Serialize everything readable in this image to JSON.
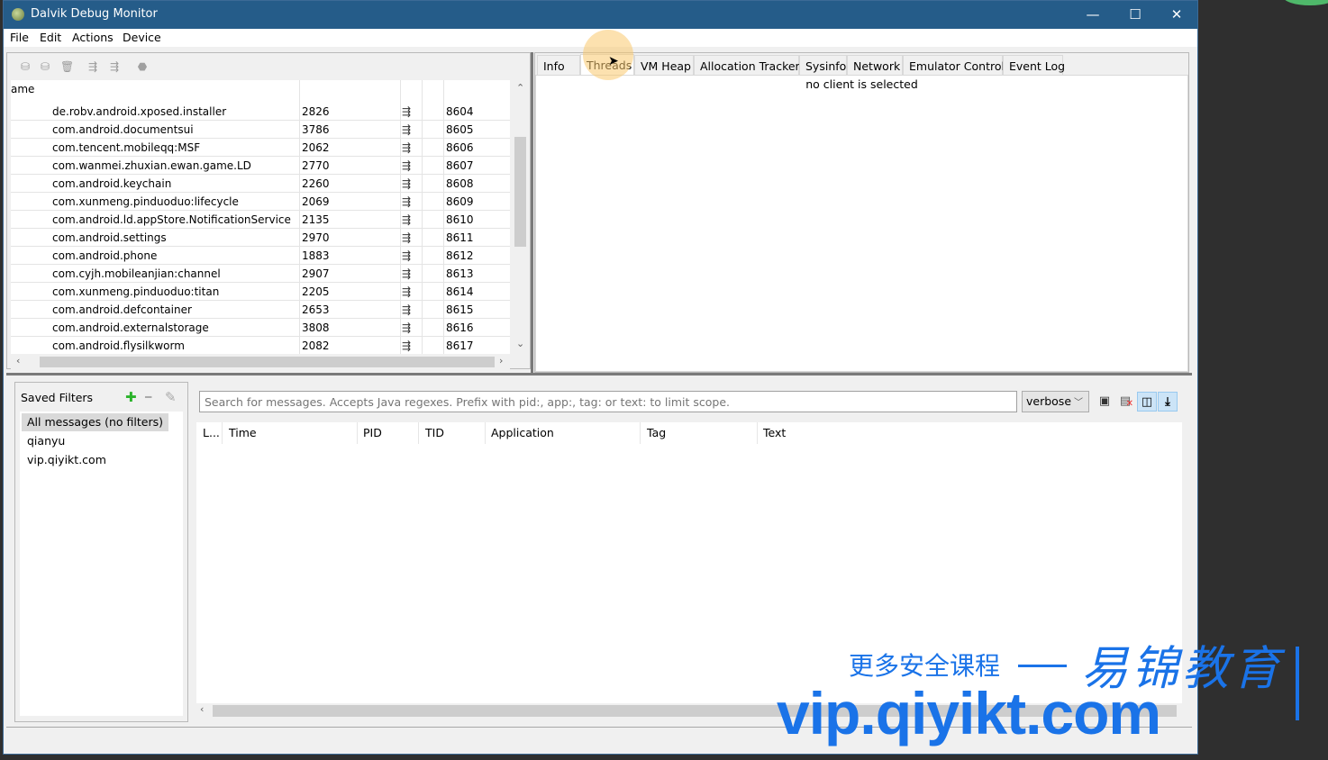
{
  "window": {
    "title": "Dalvik Debug Monitor",
    "controls": {
      "minimize": "—",
      "maximize": "☐",
      "close": "✕"
    }
  },
  "menu": [
    "File",
    "Edit",
    "Actions",
    "Device"
  ],
  "device_toolbar": [
    {
      "name": "debug-process-icon",
      "glyph": "⛁"
    },
    {
      "name": "update-heap-icon",
      "glyph": "⛁"
    },
    {
      "name": "dump-hprof-icon",
      "glyph": "🗑"
    },
    {
      "name": "cause-gc-icon",
      "glyph": "⇶"
    },
    {
      "name": "update-threads-icon",
      "glyph": "⇶"
    },
    {
      "name": "stop-process-icon",
      "glyph": "⬣"
    }
  ],
  "device_table": {
    "header_name": "ame",
    "rows": [
      {
        "name": "de.robv.android.xposed.installer",
        "pid": "2826",
        "port": "8604"
      },
      {
        "name": "com.android.documentsui",
        "pid": "3786",
        "port": "8605"
      },
      {
        "name": "com.tencent.mobileqq:MSF",
        "pid": "2062",
        "port": "8606"
      },
      {
        "name": "com.wanmei.zhuxian.ewan.game.LD",
        "pid": "2770",
        "port": "8607"
      },
      {
        "name": "com.android.keychain",
        "pid": "2260",
        "port": "8608"
      },
      {
        "name": "com.xunmeng.pinduoduo:lifecycle",
        "pid": "2069",
        "port": "8609"
      },
      {
        "name": "com.android.ld.appStore.NotificationService",
        "pid": "2135",
        "port": "8610"
      },
      {
        "name": "com.android.settings",
        "pid": "2970",
        "port": "8611"
      },
      {
        "name": "com.android.phone",
        "pid": "1883",
        "port": "8612"
      },
      {
        "name": "com.cyjh.mobileanjian:channel",
        "pid": "2907",
        "port": "8613"
      },
      {
        "name": "com.xunmeng.pinduoduo:titan",
        "pid": "2205",
        "port": "8614"
      },
      {
        "name": "com.android.defcontainer",
        "pid": "2653",
        "port": "8615"
      },
      {
        "name": "com.android.externalstorage",
        "pid": "3808",
        "port": "8616"
      },
      {
        "name": "com.android.flysilkworm",
        "pid": "2082",
        "port": "8617"
      }
    ],
    "thread_glyph": "⇶"
  },
  "tabs": {
    "items": [
      "Info",
      "Threads",
      "VM Heap",
      "Allocation Tracker",
      "Sysinfo",
      "Network",
      "Emulator Control",
      "Event Log"
    ],
    "active": "Threads",
    "content_message": "no client is selected"
  },
  "logcat": {
    "saved_filters_label": "Saved Filters",
    "filter_buttons": {
      "add": "✚",
      "remove": "━",
      "edit": "✎"
    },
    "filters": [
      "All messages (no filters)",
      "qianyu",
      "vip.qiyikt.com"
    ],
    "selected_filter": "All messages (no filters)",
    "search_placeholder": "Search for messages. Accepts Java regexes. Prefix with pid:, app:, tag: or text: to limit scope.",
    "search_value": "",
    "log_level": "verbose",
    "columns": [
      "L...",
      "Time",
      "PID",
      "TID",
      "Application",
      "Tag",
      "Text"
    ],
    "buttons": {
      "save": "💾",
      "clear": "🗎",
      "toggle_view": "◫",
      "scroll_lock": "⤓"
    }
  },
  "watermark": {
    "line1": "更多安全课程",
    "brand": "易锦教育",
    "url": "vip.qiyikt.com"
  },
  "colors": {
    "titlebar": "#255c89",
    "watermark": "#1a73e8",
    "cursor_highlight": "#f5c46e"
  }
}
